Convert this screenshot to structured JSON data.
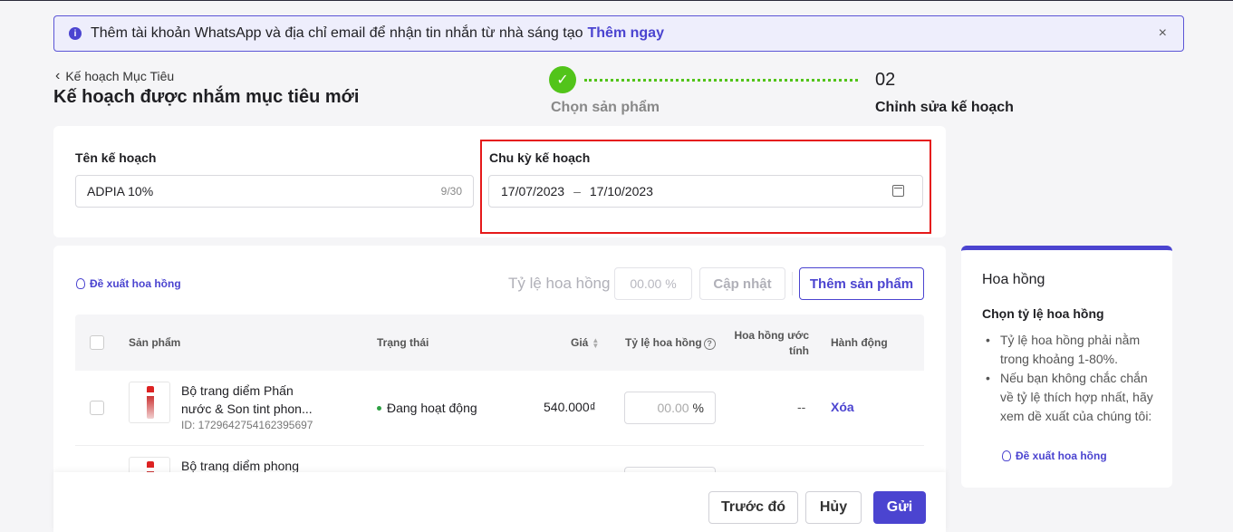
{
  "banner": {
    "message": "Thêm tài khoản WhatsApp và địa chỉ email để nhận tin nhắn từ nhà sáng tạo",
    "link": "Thêm ngay",
    "info_icon": "info-icon",
    "close_icon": "close-icon"
  },
  "header": {
    "back_label": "Kế hoạch Mục Tiêu",
    "title": "Kế hoạch được nhắm mục tiêu mới"
  },
  "steps": [
    {
      "num": "",
      "label": "Chọn sản phẩm",
      "state": "done"
    },
    {
      "num": "02",
      "label": "Chỉnh sửa kế hoạch",
      "state": "active"
    }
  ],
  "plan": {
    "name_label": "Tên kế hoạch",
    "name_value": "ADPIA 10%",
    "name_count": "9/30",
    "cycle_label": "Chu kỳ kế hoạch",
    "start_date": "17/07/2023",
    "date_sep": "–",
    "end_date": "17/10/2023"
  },
  "toolbar": {
    "suggest_label": "Đề xuất hoa hồng",
    "rate_label": "Tỷ lệ hoa hồng",
    "rate_placeholder": "00.00 %",
    "update_label": "Cập nhật",
    "add_label": "Thêm sản phẩm"
  },
  "table": {
    "headers": {
      "product": "Sản phẩm",
      "status": "Trạng thái",
      "price": "Giá",
      "rate": "Tỷ lệ hoa hồng",
      "est_1": "Hoa hồng ước",
      "est_2": "tính",
      "action": "Hành động"
    },
    "rows": [
      {
        "name_1": "Bộ trang diểm Phấn",
        "name_2": "nước & Son tint phon...",
        "id": "ID: 1729642754162395697",
        "status": "Đang hoạt động",
        "price": "540.000₫",
        "rate_placeholder": "00.00",
        "rate_unit": "%",
        "est": "--",
        "action": "Xóa"
      },
      {
        "name_1": "Bộ trang diểm phong"
      }
    ]
  },
  "footer": {
    "prev": "Trước đó",
    "cancel": "Hủy",
    "send": "Gửi"
  },
  "sidebar": {
    "title": "Hoa hồng",
    "subtitle": "Chọn tỷ lệ hoa hồng",
    "bullets": [
      "Tỷ lệ hoa hồng phải nằm trong khoảng 1-80%.",
      "Nếu bạn không chắc chắn về tỷ lệ thích hợp nhất, hãy xem dề xuất của chúng tôi:"
    ],
    "suggest_label": "Đề xuất hoa hồng"
  },
  "colors": {
    "accent": "#4b44d0",
    "success": "#52c41a",
    "highlight": "#e5191a"
  }
}
